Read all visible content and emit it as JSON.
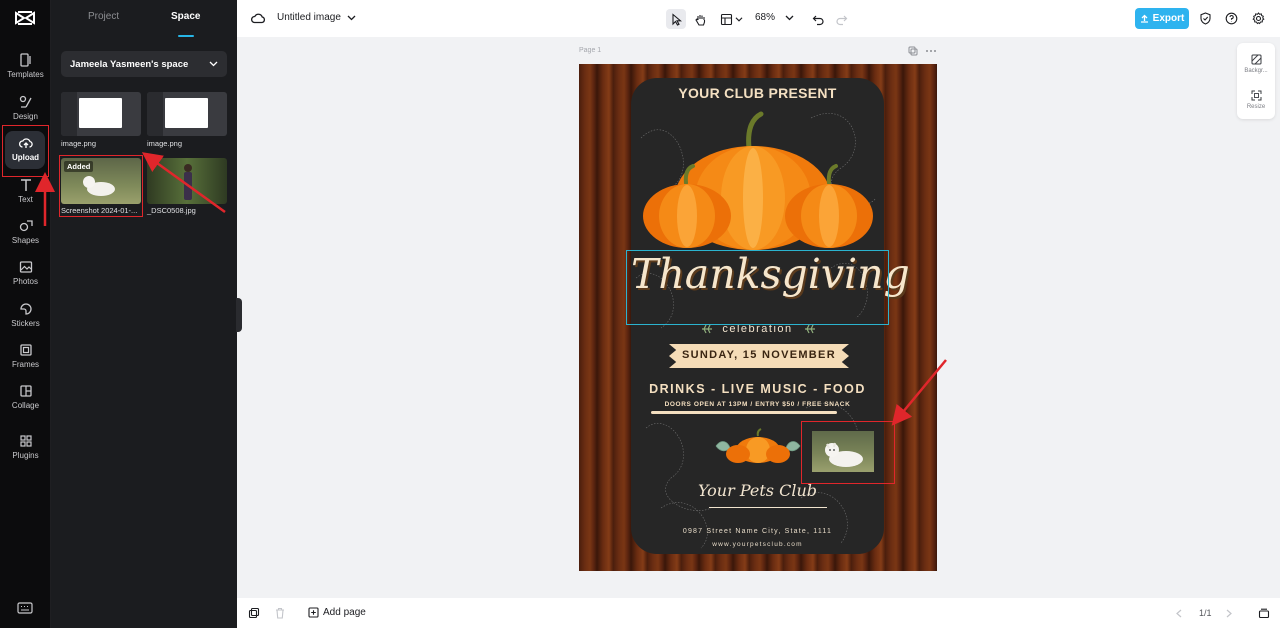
{
  "rail": {
    "items": [
      {
        "label": "Templates",
        "icon": "templates-icon"
      },
      {
        "label": "Design",
        "icon": "design-icon"
      },
      {
        "label": "Upload",
        "icon": "upload-cloud-icon",
        "active": true
      },
      {
        "label": "Text",
        "icon": "text-icon"
      },
      {
        "label": "Shapes",
        "icon": "shapes-icon"
      },
      {
        "label": "Photos",
        "icon": "photos-icon"
      },
      {
        "label": "Stickers",
        "icon": "stickers-icon"
      },
      {
        "label": "Frames",
        "icon": "frames-icon"
      },
      {
        "label": "Collage",
        "icon": "collage-icon"
      },
      {
        "label": "Plugins",
        "icon": "plugins-icon"
      }
    ]
  },
  "panel": {
    "tabs": [
      "Project",
      "Space"
    ],
    "active_tab": "Space",
    "space_name": "Jameela Yasmeen's space",
    "files": [
      {
        "name": "image.png"
      },
      {
        "name": "image.png"
      },
      {
        "name": "Screenshot 2024-01-...",
        "badge": "Added"
      },
      {
        "name": "_DSC0508.jpg"
      }
    ]
  },
  "topbar": {
    "title": "Untitled image",
    "zoom": "68%",
    "export_label": "Export"
  },
  "canvas": {
    "page_label": "Page 1",
    "right_tools": [
      "Backgr...",
      "Resize"
    ]
  },
  "poster": {
    "header": "YOUR CLUB PRESENT",
    "title": "Thanksgiving",
    "subtitle": "celebration",
    "date": "SUNDAY, 15 NOVEMBER",
    "activities": "DRINKS - LIVE MUSIC - FOOD",
    "doors": "DOORS OPEN AT 13PM / ENTRY $50 / FREE SNACK",
    "club": "Your Pets Club",
    "address": "0987 Street Name City, State, 1111",
    "website": "www.yourpetsclub.com"
  },
  "bottombar": {
    "add_page": "Add page",
    "pager": "1/1"
  },
  "colors": {
    "accent": "#2eb3ef",
    "annotation": "#e0262b",
    "selection": "#2bb3cf"
  }
}
